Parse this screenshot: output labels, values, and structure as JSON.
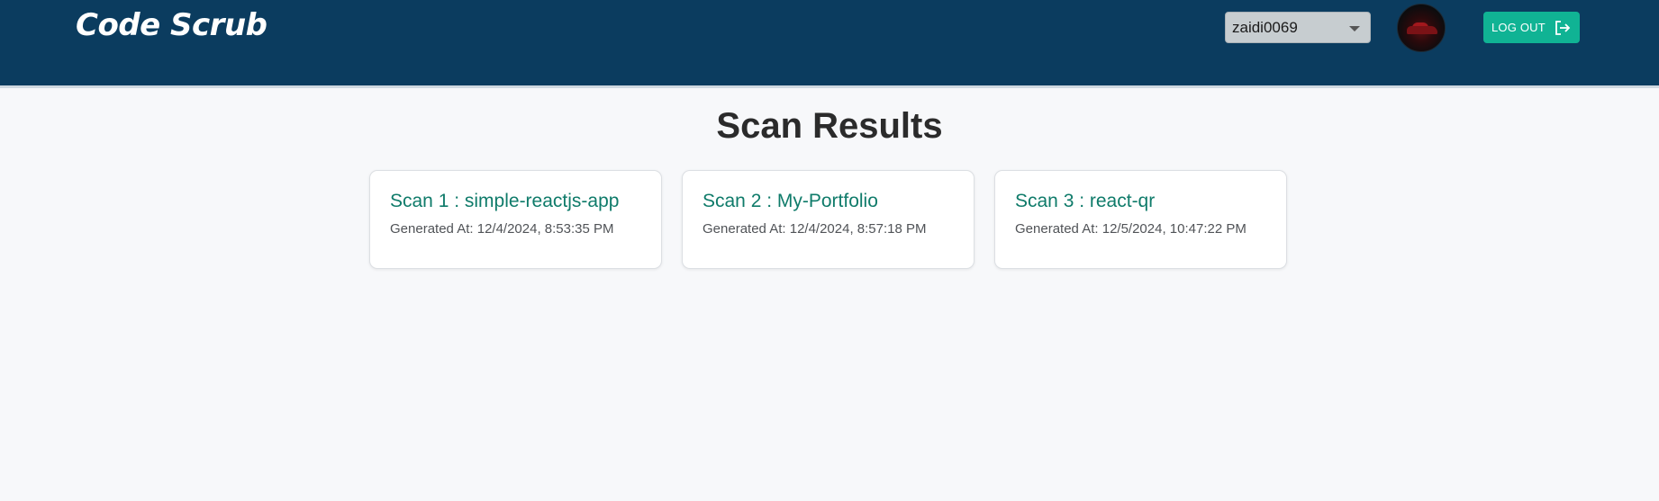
{
  "header": {
    "brand": "Code Scrub",
    "user_select": {
      "selected": "zaidi0069"
    },
    "logout_label": "LOG OUT",
    "colors": {
      "background": "#0b3c5f",
      "logout": "#10b394"
    }
  },
  "main": {
    "title": "Scan Results",
    "scans": [
      {
        "title": "Scan 1 : simple-reactjs-app",
        "generated": "Generated At: 12/4/2024, 8:53:35 PM"
      },
      {
        "title": "Scan 2 : My-Portfolio",
        "generated": "Generated At: 12/4/2024, 8:57:18 PM"
      },
      {
        "title": "Scan 3 : react-qr",
        "generated": "Generated At: 12/5/2024, 10:47:22 PM"
      }
    ]
  }
}
